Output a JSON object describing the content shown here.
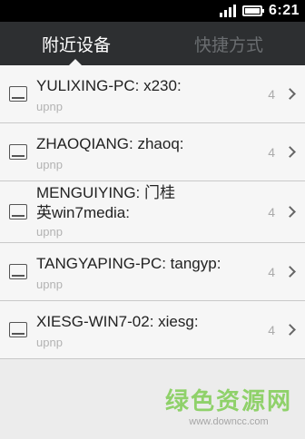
{
  "status": {
    "time": "6:21",
    "signal_level": 4,
    "battery_level": 1.0
  },
  "tabs": [
    {
      "label": "附近设备",
      "active": true
    },
    {
      "label": "快捷方式",
      "active": false
    }
  ],
  "devices": [
    {
      "name": "YULIXING-PC: x230:",
      "protocol": "upnp",
      "count": "4",
      "icon": "monitor-icon"
    },
    {
      "name": "ZHAOQIANG: zhaoq:",
      "protocol": "upnp",
      "count": "4",
      "icon": "monitor-icon"
    },
    {
      "name_line1": "MENGUIYING: 门桂",
      "name_line2": "英win7media:",
      "protocol": "upnp",
      "count": "4",
      "icon": "monitor-icon"
    },
    {
      "name": "TANGYAPING-PC: tangyp:",
      "protocol": "upnp",
      "count": "4",
      "icon": "monitor-icon"
    },
    {
      "name": "XIESG-WIN7-02: xiesg:",
      "protocol": "upnp",
      "count": "4",
      "icon": "monitor-icon"
    }
  ],
  "watermark": {
    "main": "绿色资源网",
    "url": "www.downcc.com"
  }
}
